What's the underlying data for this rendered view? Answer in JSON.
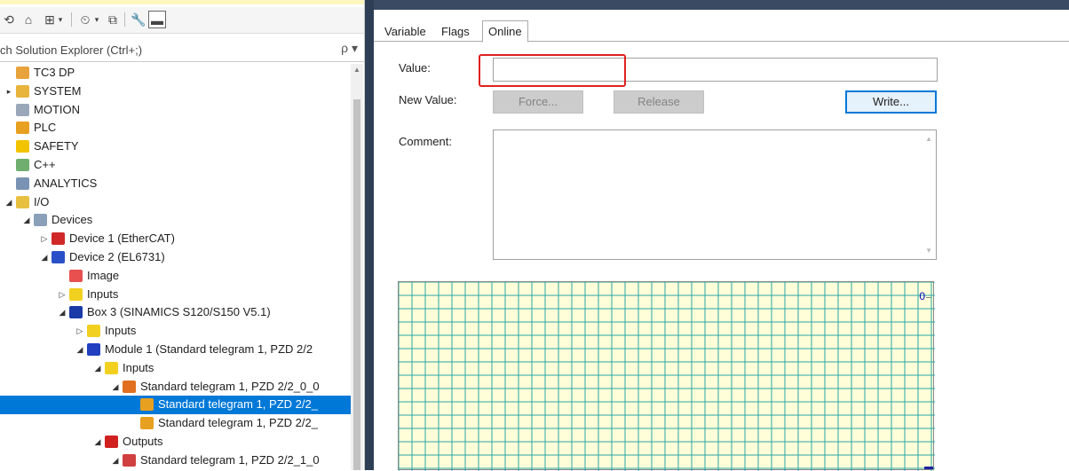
{
  "explorer": {
    "search_placeholder": "ch Solution Explorer (Ctrl+;)",
    "search_icon_glyph": "ρ ▾",
    "toolbar_glyphs": [
      "⟲",
      "⌂",
      "⊞",
      "▾",
      "⏲",
      "▾",
      "⧉",
      "🔧",
      "▬"
    ],
    "tree": [
      {
        "label": "TC3 DP",
        "icon": "project-icon",
        "color": "#e8a33c",
        "exp": ""
      },
      {
        "label": "SYSTEM",
        "icon": "system-icon",
        "color": "#e8b43c",
        "exp": "▸"
      },
      {
        "label": "MOTION",
        "icon": "motion-icon",
        "color": "#9aa7b8",
        "exp": ""
      },
      {
        "label": "PLC",
        "icon": "plc-icon",
        "color": "#e8a020",
        "exp": ""
      },
      {
        "label": "SAFETY",
        "icon": "safety-icon",
        "color": "#f2c400",
        "exp": ""
      },
      {
        "label": "C++",
        "icon": "cpp-icon",
        "color": "#6fae6f",
        "exp": ""
      },
      {
        "label": "ANALYTICS",
        "icon": "analytics-icon",
        "color": "#7a93b5",
        "exp": ""
      },
      {
        "label": "I/O",
        "icon": "io-icon",
        "color": "#e8c040",
        "exp": "◢"
      },
      {
        "label": "Devices",
        "icon": "devices-icon",
        "color": "#8aa0b8",
        "exp": "◢"
      },
      {
        "label": "Device 1 (EtherCAT)",
        "icon": "ethercat-icon",
        "color": "#d02828",
        "exp": "▷"
      },
      {
        "label": "Device 2 (EL6731)",
        "icon": "el6731-icon",
        "color": "#2a50c8",
        "exp": "◢"
      },
      {
        "label": "Image",
        "icon": "image-icon",
        "color": "#e85050",
        "exp": ""
      },
      {
        "label": "Inputs",
        "icon": "inputs-folder-icon",
        "color": "#f2d020",
        "exp": "▷"
      },
      {
        "label": "Box 3 (SINAMICS S120/S150 V5.1)",
        "icon": "box-icon",
        "color": "#1a3aa8",
        "exp": "◢"
      },
      {
        "label": "Inputs",
        "icon": "inputs-folder-icon",
        "color": "#f2d020",
        "exp": "▷"
      },
      {
        "label": "Module 1 (Standard telegram 1, PZD 2/2",
        "icon": "module-icon",
        "color": "#2040c0",
        "exp": "◢"
      },
      {
        "label": "Inputs",
        "icon": "inputs-folder-icon",
        "color": "#f2d020",
        "exp": "◢"
      },
      {
        "label": "Standard telegram 1, PZD 2/2_0_0",
        "icon": "telegram-icon",
        "color": "#e07020",
        "exp": "◢"
      },
      {
        "label": "Standard telegram 1, PZD 2/2_",
        "icon": "telegram-var-icon",
        "color": "#e8a020",
        "exp": "",
        "selected": true
      },
      {
        "label": "Standard telegram 1, PZD 2/2_",
        "icon": "telegram-var-icon",
        "color": "#e8a020",
        "exp": ""
      },
      {
        "label": "Outputs",
        "icon": "outputs-folder-icon",
        "color": "#d02020",
        "exp": "◢"
      },
      {
        "label": "Standard telegram 1, PZD 2/2_1_0",
        "icon": "telegram-out-icon",
        "color": "#d04040",
        "exp": "◢"
      }
    ]
  },
  "tabs": [
    {
      "label": "Variable"
    },
    {
      "label": "Flags"
    },
    {
      "label": "Online",
      "active": true
    }
  ],
  "online": {
    "value_label": "Value:",
    "value": "",
    "new_value_label": "New Value:",
    "force_label": "Force...",
    "release_label": "Release",
    "write_label": "Write...",
    "comment_label": "Comment:",
    "comment": "",
    "chart_scale_label": "0"
  },
  "colors": {
    "selection": "#0078d7",
    "highlight_box": "#e02020",
    "chart_bg": "#fffed8",
    "chart_grid": "#2aa7a7"
  }
}
